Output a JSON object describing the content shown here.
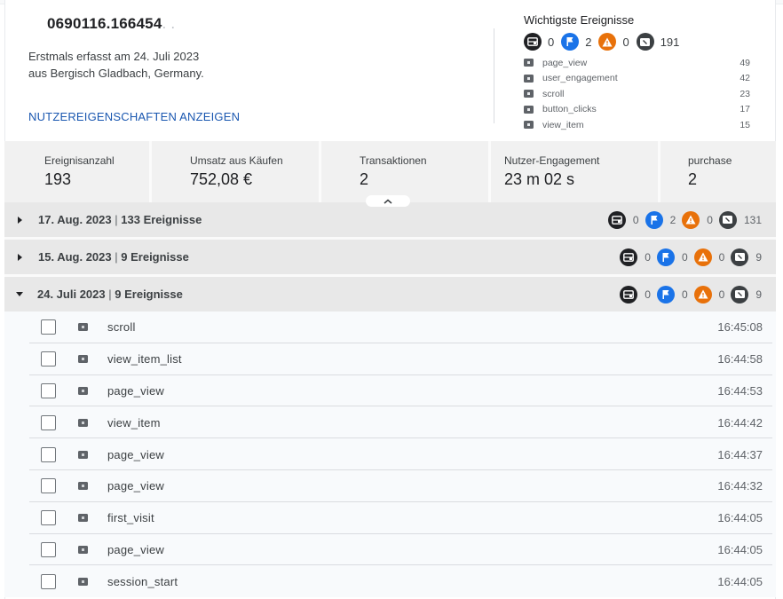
{
  "user": {
    "id": "0690116.166454",
    "id_trailing": ". .",
    "first_seen_line1": "Erstmals erfasst am 24. Juli 2023",
    "first_seen_line2": "aus Bergisch Gladbach, Germany.",
    "show_properties_label": "NUTZEREIGENSCHAFTEN ANZEIGEN"
  },
  "top_events": {
    "title": "Wichtigste Ereignisse",
    "badges": [
      {
        "icon": "web-stories-icon",
        "color": "#202124",
        "count": "0"
      },
      {
        "icon": "flag-icon",
        "color": "#1a73e8",
        "count": "2"
      },
      {
        "icon": "warning-icon",
        "color": "#e8710a",
        "count": "0"
      },
      {
        "icon": "event-icon",
        "color": "#3c4043",
        "count": "191"
      }
    ],
    "items": [
      {
        "name": "page_view",
        "count": "49"
      },
      {
        "name": "user_engagement",
        "count": "42"
      },
      {
        "name": "scroll",
        "count": "23"
      },
      {
        "name": "button_clicks",
        "count": "17"
      },
      {
        "name": "view_item",
        "count": "15"
      }
    ]
  },
  "stats": [
    {
      "label": "Ereignisanzahl",
      "value": "193"
    },
    {
      "label": "Umsatz aus Käufen",
      "value": "752,08 €"
    },
    {
      "label": "Transaktionen",
      "value": "2"
    },
    {
      "label": "Nutzer-Engagement",
      "value": "23 m 02 s"
    },
    {
      "label": "purchase",
      "value": "2"
    }
  ],
  "days": [
    {
      "date": "17. Aug. 2023",
      "events_label": "133 Ereignisse",
      "expanded": false,
      "counts": [
        "0",
        "2",
        "0",
        "131"
      ]
    },
    {
      "date": "15. Aug. 2023",
      "events_label": "9 Ereignisse",
      "expanded": false,
      "counts": [
        "0",
        "0",
        "0",
        "9"
      ]
    },
    {
      "date": "24. Juli 2023",
      "events_label": "9 Ereignisse",
      "expanded": true,
      "counts": [
        "0",
        "0",
        "0",
        "9"
      ]
    }
  ],
  "separator": "|",
  "events": [
    {
      "name": "scroll",
      "time": "16:45:08"
    },
    {
      "name": "view_item_list",
      "time": "16:44:58"
    },
    {
      "name": "page_view",
      "time": "16:44:53"
    },
    {
      "name": "view_item",
      "time": "16:44:42"
    },
    {
      "name": "page_view",
      "time": "16:44:37"
    },
    {
      "name": "page_view",
      "time": "16:44:32"
    },
    {
      "name": "first_visit",
      "time": "16:44:05"
    },
    {
      "name": "page_view",
      "time": "16:44:05"
    },
    {
      "name": "session_start",
      "time": "16:44:05"
    }
  ]
}
